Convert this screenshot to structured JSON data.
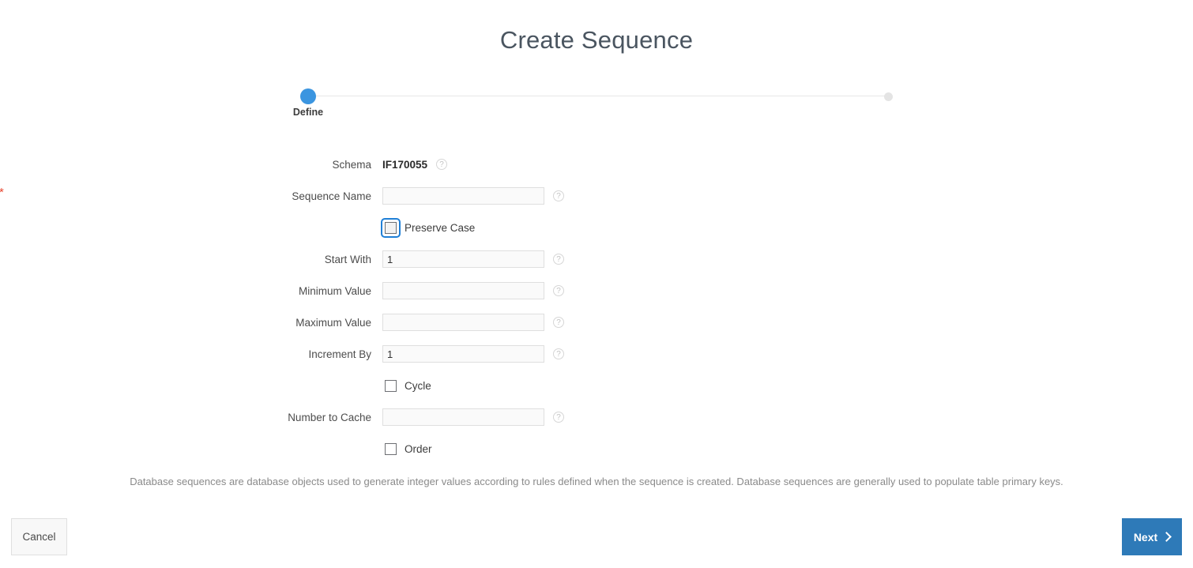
{
  "page": {
    "title": "Create Sequence"
  },
  "steps": [
    {
      "label": "Define",
      "state": "active"
    },
    {
      "label": "",
      "state": "inactive"
    }
  ],
  "form": {
    "schema": {
      "label": "Schema",
      "value": "IF170055",
      "help_icon": "?"
    },
    "sequence_name": {
      "label": "Sequence Name",
      "required_marker": "*",
      "value": "",
      "placeholder": "",
      "help_icon": "?"
    },
    "preserve_case": {
      "label": "Preserve Case",
      "checked": false,
      "focused": true
    },
    "start_with": {
      "label": "Start With",
      "value": "1",
      "help_icon": "?"
    },
    "minimum_value": {
      "label": "Minimum Value",
      "value": "",
      "help_icon": "?"
    },
    "maximum_value": {
      "label": "Maximum Value",
      "value": "",
      "help_icon": "?"
    },
    "increment_by": {
      "label": "Increment By",
      "value": "1",
      "help_icon": "?"
    },
    "cycle": {
      "label": "Cycle",
      "checked": false
    },
    "number_to_cache": {
      "label": "Number to Cache",
      "value": "",
      "help_icon": "?"
    },
    "order": {
      "label": "Order",
      "checked": false
    }
  },
  "help_text": "Database sequences are database objects used to generate integer values according to rules defined when the sequence is created. Database sequences are generally used to populate table primary keys.",
  "footer": {
    "cancel_label": "Cancel",
    "next_label": "Next"
  },
  "colors": {
    "accent_blue": "#3b95e0",
    "button_blue": "#2e7ab8",
    "required_red": "#e8462f",
    "focus_ring": "#1f7fd6"
  }
}
